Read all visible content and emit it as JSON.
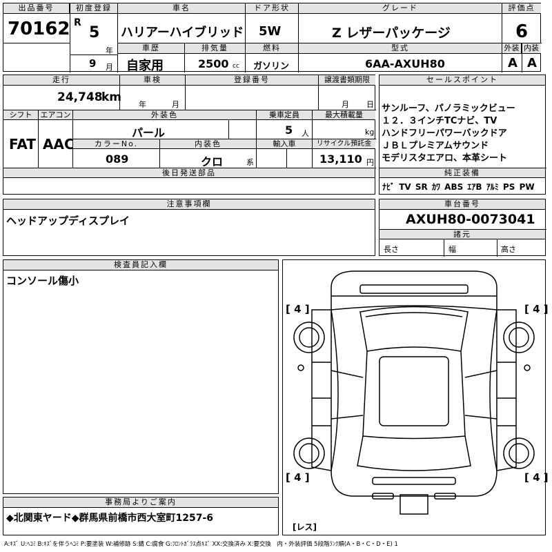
{
  "header": {
    "lot_no_label": "出品番号",
    "lot_no": "70162",
    "first_reg_label": "初度登録",
    "era": "R",
    "year": "5",
    "year_unit": "年",
    "month": "9",
    "month_unit": "月",
    "car_name_label": "車名",
    "car_name": "ハリアーハイブリッド",
    "door_label": "ドア形状",
    "door": "5W",
    "grade_label": "グレード",
    "grade": "Z レザーパッケージ",
    "score_label": "評価点",
    "score": "6",
    "history_label": "車歴",
    "history": "自家用",
    "displacement_label": "排気量",
    "displacement": "2500",
    "displacement_unit": "cc",
    "fuel_label": "燃料",
    "fuel": "ガソリン",
    "model_label": "型式",
    "model": "6AA-AXUH80",
    "exterior_label": "外装",
    "exterior": "A",
    "interior_label": "内装",
    "interior": "A"
  },
  "row2": {
    "mileage_label": "走行",
    "mileage": "24,748",
    "mileage_unit": "km",
    "inspection_label": "車検",
    "insp_year_unit": "年",
    "insp_month_unit": "月",
    "reg_no_label": "登録番号",
    "transfer_label": "譲渡書類期限",
    "transfer_month_unit": "月",
    "transfer_day_unit": "日",
    "shift_label": "シフト",
    "shift": "FAT",
    "ac_label": "エアコン",
    "ac": "AAC",
    "color_label": "外装色",
    "color": "パール",
    "capacity_label": "乗車定員",
    "capacity": "5",
    "capacity_unit": "人",
    "load_label": "最大積載量",
    "load_unit": "kg",
    "color_no_label": "カラーNo.",
    "color_no": "089",
    "int_color_label": "内装色",
    "int_color": "クロ",
    "int_color_unit": "系",
    "import_label": "輸入車",
    "recycle_label": "リサイクル預託金",
    "recycle": "13,110",
    "recycle_unit": "円",
    "later_parts_label": "後日発送部品"
  },
  "sales": {
    "label": "セールスポイント",
    "lines": [
      "サンルーフ、パノラミックビュー",
      "１２．３インチTCナビ、TV",
      "ハンドフリーパワーバックドア",
      "ＪＢＬプレミアムサウンド",
      "モデリスタエアロ、本革シート"
    ],
    "equipment_label": "純正装備",
    "equipment": [
      "ﾅﾋﾞ",
      "TV",
      "SR",
      "ｶﾜ",
      "ABS",
      "ｴｱB",
      "ｱﾙﾐ",
      "PS",
      "PW"
    ]
  },
  "notes": {
    "label": "注意事項欄",
    "text": "ヘッドアップディスプレイ"
  },
  "chassis": {
    "label": "車台番号",
    "value": "AXUH80-0073041",
    "spec_label": "諸元",
    "length_label": "長さ",
    "width_label": "幅",
    "height_label": "高さ"
  },
  "inspector": {
    "label": "検査員記入欄",
    "text": "コンソール傷小"
  },
  "diagram": {
    "tire_fl": "[ 4 ]",
    "tire_fr": "[ 4 ]",
    "tire_rl": "[ 4 ]",
    "tire_rr": "[ 4 ]",
    "spare": "[レス]"
  },
  "office": {
    "label": "事務局よりご案内",
    "text": "◆北関東ヤード◆群馬県前橋市西大室町1257-6"
  },
  "legend": "A:ｷｽﾞ U:ﾍｺﾐ B:ｷｽﾞを伴うﾍｺﾐ P:要塗装 W:補修跡 S:錆 C:腐食 G:ﾌﾛﾝﾄｶﾞﾗｽ点ｷｽﾞ XX:交換済み X:要交換　内・外装評価 5段階ﾗﾝｸ順(A・B・C・D・E) 1"
}
